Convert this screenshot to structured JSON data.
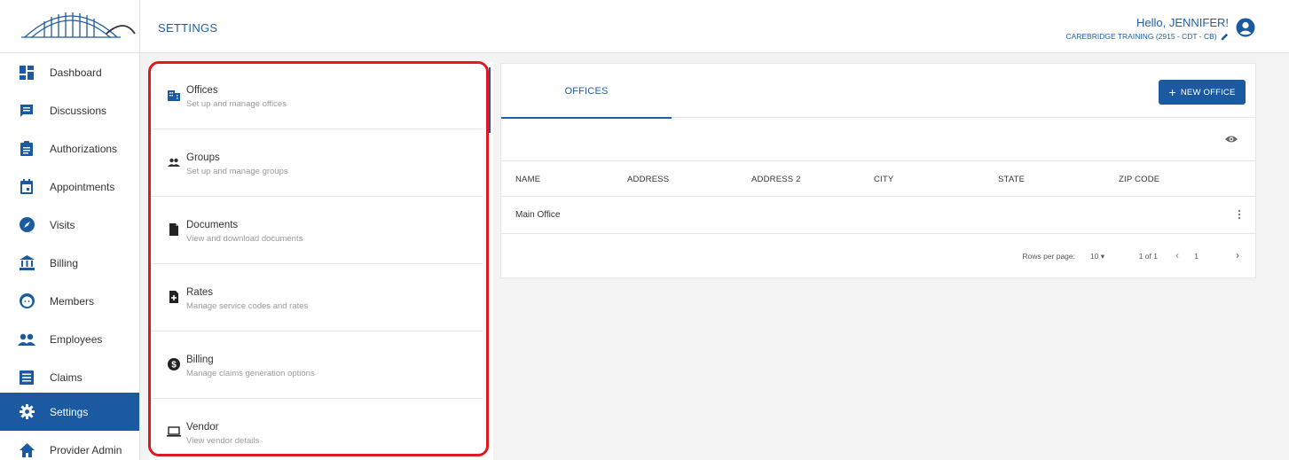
{
  "header": {
    "title": "SETTINGS",
    "greeting": "Hello, JENNIFER!",
    "account": "CAREBRIDGE TRAINING (2915 - CDT - CB)"
  },
  "sidebar": {
    "items": [
      {
        "label": "Dashboard",
        "icon": "dashboard-icon"
      },
      {
        "label": "Discussions",
        "icon": "chat-icon"
      },
      {
        "label": "Authorizations",
        "icon": "clipboard-icon"
      },
      {
        "label": "Appointments",
        "icon": "calendar-icon"
      },
      {
        "label": "Visits",
        "icon": "compass-icon"
      },
      {
        "label": "Billing",
        "icon": "bank-icon"
      },
      {
        "label": "Members",
        "icon": "face-icon"
      },
      {
        "label": "Employees",
        "icon": "people-icon"
      },
      {
        "label": "Claims",
        "icon": "list-icon"
      },
      {
        "label": "Settings",
        "icon": "gear-icon",
        "active": true
      },
      {
        "label": "Provider Admin",
        "icon": "home-icon"
      }
    ]
  },
  "settings_list": [
    {
      "title": "Offices",
      "description": "Set up and manage offices",
      "icon": "building-icon"
    },
    {
      "title": "Groups",
      "description": "Set up and manage groups",
      "icon": "group-icon"
    },
    {
      "title": "Documents",
      "description": "View and download documents",
      "icon": "document-icon"
    },
    {
      "title": "Rates",
      "description": "Manage service codes and rates",
      "icon": "rate-file-icon"
    },
    {
      "title": "Billing",
      "description": "Manage claims generation options",
      "icon": "dollar-icon"
    },
    {
      "title": "Vendor",
      "description": "View vendor details",
      "icon": "laptop-icon"
    }
  ],
  "offices": {
    "tab_label": "OFFICES",
    "new_button": "NEW OFFICE",
    "columns": [
      "NAME",
      "ADDRESS",
      "ADDRESS 2",
      "CITY",
      "STATE",
      "ZIP CODE"
    ],
    "rows": [
      [
        "Main Office",
        "",
        "",
        "",
        "",
        ""
      ]
    ],
    "pagination": {
      "rows_per_page_label": "Rows per page:",
      "rows_per_page": "10",
      "range": "1 of 1",
      "page": "1"
    }
  },
  "colors": {
    "primary": "#1b5aa0",
    "highlight": "#e0181f",
    "background": "#f3f3f3"
  }
}
